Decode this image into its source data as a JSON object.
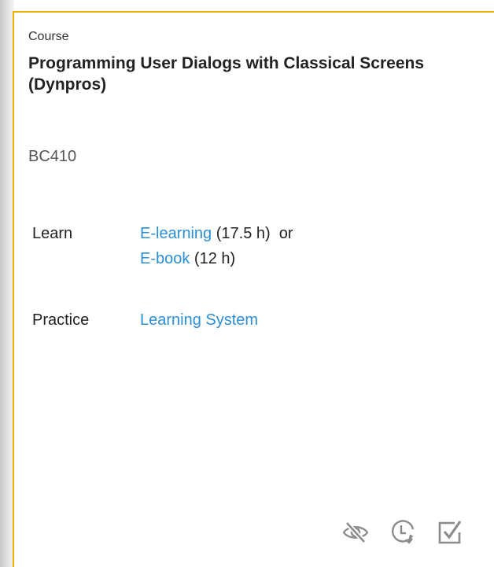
{
  "card": {
    "type_label": "Course",
    "title": "Programming User Dialogs with Classical Screens (Dynpros)",
    "code": "BC410",
    "accent_color": "#f0ab00",
    "link_color": "#2a8fd6"
  },
  "learn": {
    "label": "Learn",
    "elearning_link": "E-learning",
    "elearning_duration": " (17.5 h)",
    "or_text": "  or",
    "ebook_link": "E-book",
    "ebook_duration": " (12 h)"
  },
  "practice": {
    "label": "Practice",
    "link": "Learning System"
  },
  "actions": {
    "hide_icon": "eye-slash-icon",
    "history_icon": "clock-arrow-icon",
    "complete_icon": "checkbox-icon"
  }
}
